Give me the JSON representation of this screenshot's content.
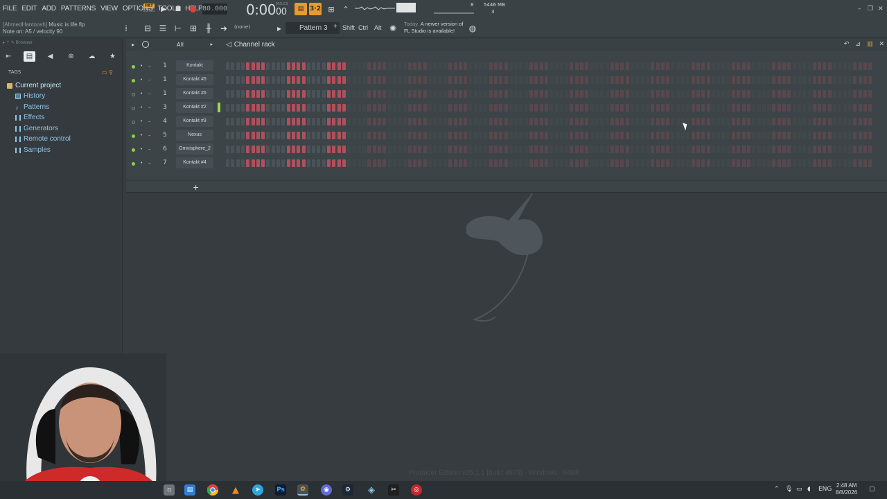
{
  "menu": [
    "FILE",
    "EDIT",
    "ADD",
    "PATTERNS",
    "VIEW",
    "OPTIONS",
    "TOOLS",
    "HELP"
  ],
  "project": {
    "user": "[AhmedHantoosh]",
    "file": "Music is life.flp",
    "hint": "Note on: A5 / velocity 90"
  },
  "transport": {
    "pat": "PAT",
    "song": "SONG",
    "tempo": "80.000",
    "time_main": "0:00",
    "time_sub": "00",
    "time_unit": "M:S:CS"
  },
  "perf": {
    "cpu_val": "8",
    "mem": "5446 MB",
    "poly": "3"
  },
  "toolbar": {
    "snap_value": "(none)",
    "pattern": "Pattern 3",
    "mod_shift": "Shift",
    "mod_ctrl": "Ctrl",
    "mod_alt": "Alt"
  },
  "news": {
    "today": "Today",
    "line1": "A newer version of",
    "line2": "FL Studio is available!"
  },
  "browser": {
    "title": "Browser",
    "tags_label": "TAGS",
    "root": "Current project",
    "items": [
      "History",
      "Patterns",
      "Effects",
      "Generators",
      "Remote control",
      "Samples"
    ]
  },
  "rack": {
    "filter": "All",
    "title": "Channel rack",
    "channels": [
      {
        "num": "1",
        "name": "Kontakt",
        "led": "on"
      },
      {
        "num": "1",
        "name": "Kontakt #5",
        "led": "on"
      },
      {
        "num": "1",
        "name": "Kontakt #6",
        "led": "off"
      },
      {
        "num": "3",
        "name": "Kontakt #2",
        "led": "off"
      },
      {
        "num": "4",
        "name": "Kontakt #3",
        "led": "off"
      },
      {
        "num": "5",
        "name": "Nexus",
        "led": "on"
      },
      {
        "num": "6",
        "name": "Omnisphere_2",
        "led": "on"
      },
      {
        "num": "7",
        "name": "Kontakt #4",
        "led": "on"
      }
    ],
    "add_label": "+"
  },
  "status": {
    "edition": "Producer Edition v25.1.1 [build 4879] - Windows - 64Bit"
  },
  "taskbar": {
    "lang": "ENG",
    "time": "2:48 AM",
    "date": "8/8/2026"
  },
  "colors": {
    "accent_orange": "#e89a2c",
    "step_red": "#b0505c",
    "led_green": "#8bd14a",
    "link_blue": "#8fc6e8"
  }
}
